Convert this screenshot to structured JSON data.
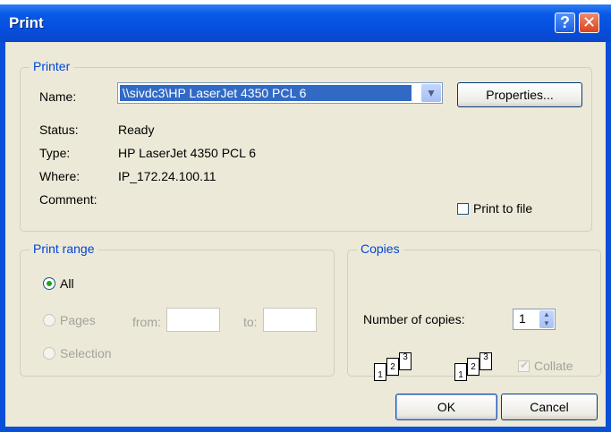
{
  "dialog": {
    "title": "Print",
    "help_label": "?",
    "close_label": "✕"
  },
  "printer": {
    "group_label": "Printer",
    "name_label": "Name:",
    "name_value": "\\\\sivdc3\\HP LaserJet 4350 PCL 6",
    "properties_label": "Properties...",
    "status_label": "Status:",
    "status_value": "Ready",
    "type_label": "Type:",
    "type_value": "HP LaserJet 4350 PCL 6",
    "where_label": "Where:",
    "where_value": "IP_172.24.100.11",
    "comment_label": "Comment:",
    "comment_value": "",
    "print_to_file_label": "Print to file"
  },
  "range": {
    "group_label": "Print range",
    "all_label": "All",
    "pages_label": "Pages",
    "from_label": "from:",
    "to_label": "to:",
    "selection_label": "Selection",
    "selected": "All"
  },
  "copies": {
    "group_label": "Copies",
    "number_label": "Number of copies:",
    "number_value": "1",
    "collate_label": "Collate",
    "collate_checked": true,
    "page_numbers": [
      "1",
      "2",
      "3"
    ]
  },
  "buttons": {
    "ok_label": "OK",
    "cancel_label": "Cancel"
  }
}
